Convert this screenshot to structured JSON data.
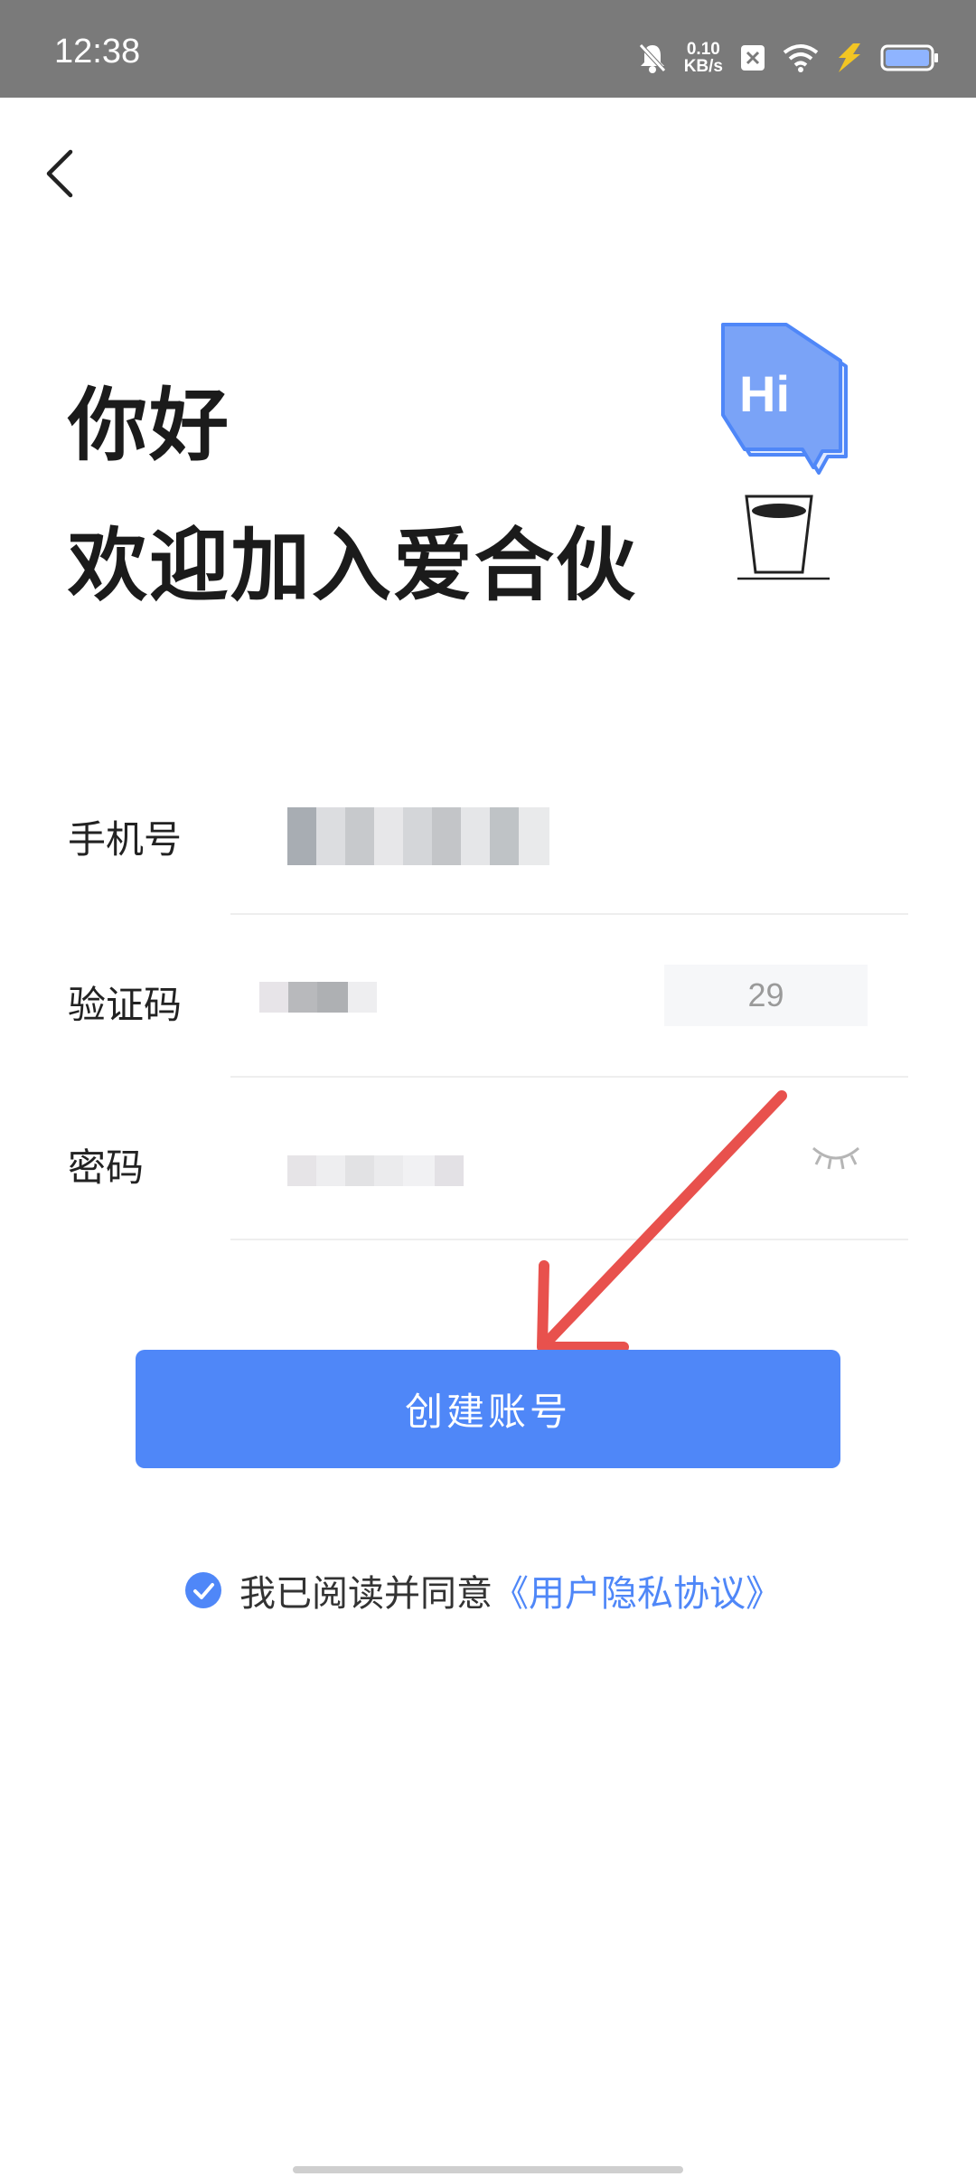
{
  "status_bar": {
    "time": "12:38",
    "net_speed_value": "0.10",
    "net_speed_unit": "KB/s"
  },
  "header": {
    "greeting": "你好",
    "welcome": "欢迎加入爱合伙",
    "illustration_text": "Hi"
  },
  "form": {
    "phone_label": "手机号",
    "code_label": "验证码",
    "code_countdown": "29",
    "password_label": "密码"
  },
  "actions": {
    "create_account": "创建账号"
  },
  "agreement": {
    "text": "我已阅读并同意",
    "link": "《用户隐私协议》",
    "checked": true
  },
  "colors": {
    "accent": "#4f87f8",
    "status_bar": "#7a7a7a",
    "arrow": "#e8514d"
  }
}
